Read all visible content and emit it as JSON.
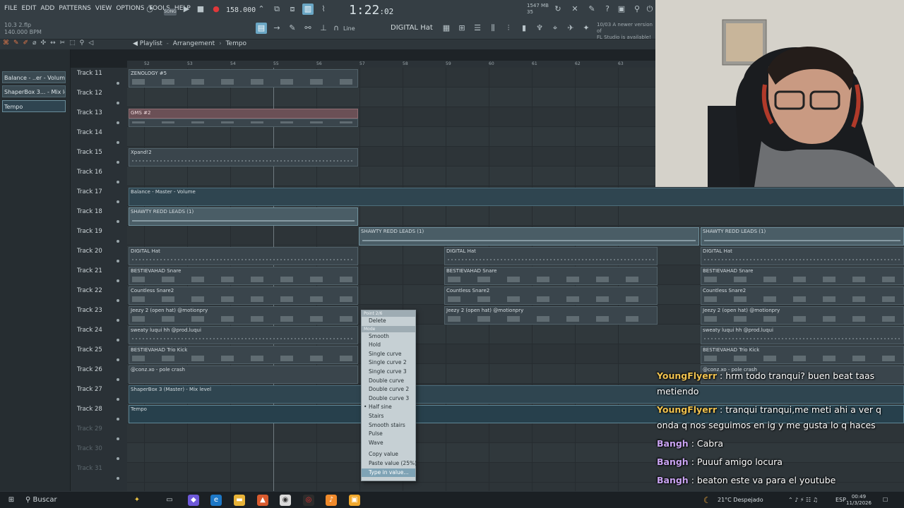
{
  "menu": [
    "FILE",
    "EDIT",
    "ADD",
    "PATTERNS",
    "VIEW",
    "OPTIONS",
    "TOOLS",
    "HELP"
  ],
  "toolbar": {
    "version_info": "10.3 2.flp",
    "bpm_info": "140.000 BPM",
    "song_mode": "SONG",
    "tempo": "158.000",
    "time_main": "1:22",
    "time_ticks": ":02",
    "cpu": "1547 MB",
    "cpu_sub": "35",
    "update_hint_line1": "10/03 A newer version of",
    "update_hint_line2": "FL Studio is available!",
    "snap": "Line",
    "current_pattern": "DIGITAL Hat"
  },
  "playlist": {
    "title": "Playlist",
    "crumbs": [
      "Arrangement",
      "Tempo"
    ]
  },
  "left_panel": [
    "Balance - ..er - Volume",
    "ShaperBox 3... - Mix level",
    "Tempo"
  ],
  "tracks": [
    {
      "label": "Track 11",
      "dim": false
    },
    {
      "label": "Track 12",
      "dim": false
    },
    {
      "label": "Track 13",
      "dim": false
    },
    {
      "label": "Track 14",
      "dim": false
    },
    {
      "label": "Track 15",
      "dim": false
    },
    {
      "label": "Track 16",
      "dim": false
    },
    {
      "label": "Track 17",
      "dim": false
    },
    {
      "label": "Track 18",
      "dim": false
    },
    {
      "label": "Track 19",
      "dim": false
    },
    {
      "label": "Track 20",
      "dim": false
    },
    {
      "label": "Track 21",
      "dim": false
    },
    {
      "label": "Track 22",
      "dim": false
    },
    {
      "label": "Track 23",
      "dim": false
    },
    {
      "label": "Track 24",
      "dim": false
    },
    {
      "label": "Track 25",
      "dim": false
    },
    {
      "label": "Track 26",
      "dim": false
    },
    {
      "label": "Track 27",
      "dim": false
    },
    {
      "label": "Track 28",
      "dim": false
    },
    {
      "label": "Track 29",
      "dim": true
    },
    {
      "label": "Track 30",
      "dim": true
    },
    {
      "label": "Track 31",
      "dim": true
    }
  ],
  "ruler": [
    "52",
    "53",
    "54",
    "55",
    "56",
    "57",
    "58",
    "59",
    "60",
    "61",
    "62",
    "63"
  ],
  "clips": {
    "zenology": "ZENOLOGY #5",
    "gms": "GMS #2",
    "xpand": "Xpand!2",
    "balance_auto": "Balance - Master - Volume",
    "shawty_1": "SHAWTY REDD LEADS (1)",
    "shawty_2": "SHAWTY REDD LEADS (1)",
    "shawty_3": "SHAWTY REDD LEADS (1)",
    "hat_1": "DIGITAL Hat",
    "hat_2": "DIGITAL Hat",
    "hat_3": "DIGITAL Hat",
    "snare_1": "BESTIEVAHAD Snare",
    "snare_2": "BESTIEVAHAD Snare",
    "snare_3": "BESTIEVAHAD Snare",
    "csnare_1": "Countless Snare2",
    "csnare_2": "Countless Snare2",
    "csnare_3": "Countless Snare2",
    "jeezy_1": "Jeezy 2 (open hat) @motionpry",
    "jeezy_2": "Jeezy 2 (open hat) @motionpry",
    "jeezy_3": "Jeezy 2 (open hat) @motionpry",
    "sweaty_1": "sweaty luqui hh @prod.luqui",
    "sweaty_2": "sweaty luqui hh @prod.luqui",
    "kick_1": "BESTIEVAHAD Trio Kick",
    "kick_2": "BESTIEVAHAD Trio Kick",
    "crash_1": "@conz.xo - pole crash",
    "crash_2": "@conz.xo - pole crash",
    "shaper_auto": "ShaperBox 3 (Master) - Mix level",
    "tempo_auto": "Tempo"
  },
  "context_menu": {
    "header": "Point 2/6",
    "mode_header": "Mode",
    "items": [
      "Delete"
    ],
    "modes": [
      "Smooth",
      "Hold",
      "Single curve",
      "Single curve 2",
      "Single curve 3",
      "Double curve",
      "Double curve 2",
      "Double curve 3",
      "Half sine",
      "Stairs",
      "Smooth stairs",
      "Pulse",
      "Wave"
    ],
    "selected_mode": "Half sine",
    "actions": [
      "Copy value",
      "Paste value (25%)",
      "Type in value..."
    ]
  },
  "chat": [
    {
      "user": "YoungFlyerr",
      "text": " : hrm todo tranqui? buen beat taas metiendo",
      "color": "#f0c24f"
    },
    {
      "user": "YoungFlyerr",
      "text": " : tranqui tranqui,me meti ahi a ver q onda q nos seguimos en ig y me gusta lo q haces",
      "color": "#f0c24f"
    },
    {
      "user": "Bangh",
      "text": " : Cabra",
      "color": "#c9a3f2"
    },
    {
      "user": "Bangh",
      "text": " : Puuuf amigo locura",
      "color": "#c9a3f2"
    },
    {
      "user": "Bangh",
      "text": " : beaton este va para el youtube",
      "color": "#c9a3f2"
    }
  ],
  "taskbar": {
    "search": "Buscar",
    "weather": "21°C Despejado",
    "lang": "ESP",
    "time": "00:49",
    "date": "11/3/2026"
  }
}
